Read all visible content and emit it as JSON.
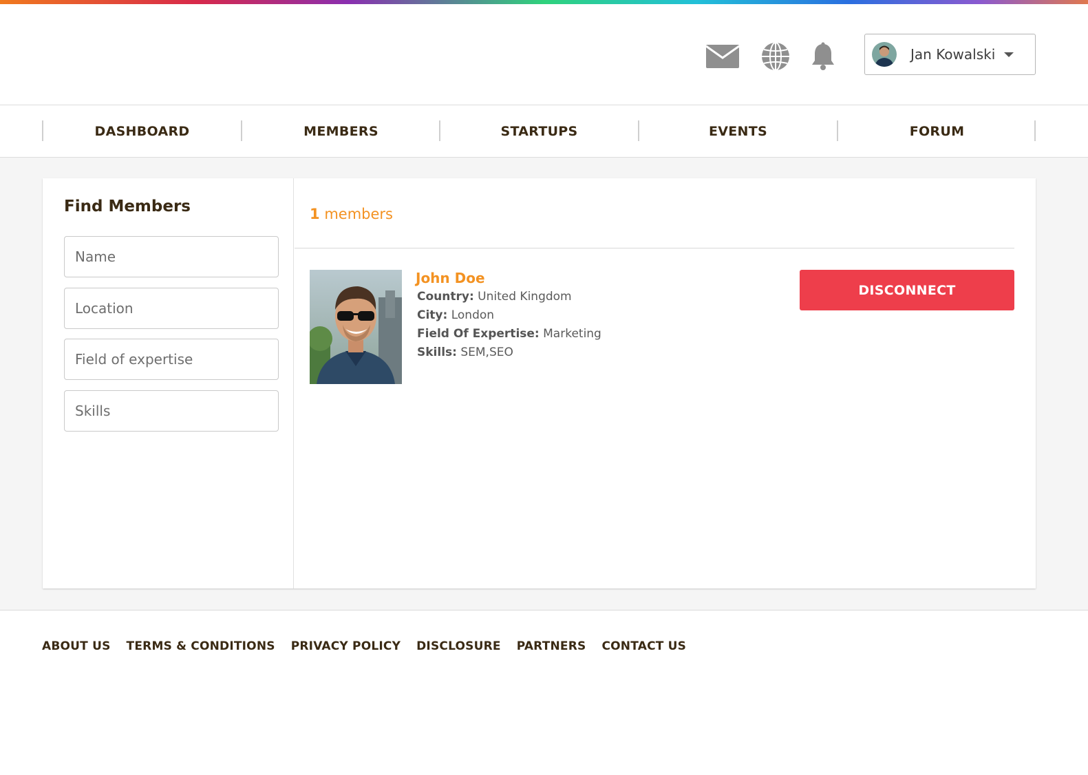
{
  "header": {
    "icons": [
      "mail-icon",
      "globe-icon",
      "bell-icon"
    ],
    "user": {
      "name": "Jan Kowalski"
    }
  },
  "nav": {
    "items": [
      {
        "label": "DASHBOARD"
      },
      {
        "label": "MEMBERS"
      },
      {
        "label": "STARTUPS"
      },
      {
        "label": "EVENTS"
      },
      {
        "label": "FORUM"
      }
    ]
  },
  "sidebar": {
    "title": "Find Members",
    "fields": {
      "name": {
        "placeholder": "Name",
        "value": ""
      },
      "location": {
        "placeholder": "Location",
        "value": ""
      },
      "expertise": {
        "placeholder": "Field of expertise",
        "value": ""
      },
      "skills": {
        "placeholder": "Skills",
        "value": ""
      }
    }
  },
  "results": {
    "count": "1",
    "count_label": "members",
    "members": [
      {
        "name": "John Doe",
        "country_label": "Country:",
        "country": "United Kingdom",
        "city_label": "City:",
        "city": "London",
        "expertise_label": "Field Of Expertise:",
        "expertise": "Marketing",
        "skills_label": "Skills:",
        "skills": "SEM,SEO",
        "action_label": "DISCONNECT"
      }
    ]
  },
  "footer": {
    "links": [
      {
        "label": "ABOUT US"
      },
      {
        "label": "TERMS & CONDITIONS"
      },
      {
        "label": "PRIVACY POLICY"
      },
      {
        "label": "DISCLOSURE"
      },
      {
        "label": "PARTNERS"
      },
      {
        "label": "CONTACT US"
      }
    ]
  },
  "colors": {
    "accent": "#f39222",
    "danger": "#ee3e4b",
    "text_dark": "#3a2a14"
  }
}
